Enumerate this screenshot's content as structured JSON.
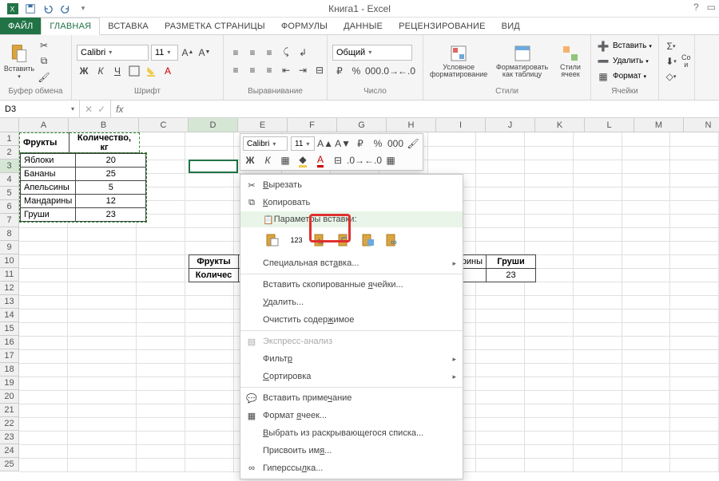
{
  "title": "Книга1 - Excel",
  "tabs": {
    "file": "ФАЙЛ",
    "home": "ГЛАВНАЯ",
    "insert": "ВСТАВКА",
    "layout": "РАЗМЕТКА СТРАНИЦЫ",
    "formulas": "ФОРМУЛЫ",
    "data": "ДАННЫЕ",
    "review": "РЕЦЕНЗИРОВАНИЕ",
    "view": "ВИД"
  },
  "ribbon": {
    "paste": "Вставить",
    "clipboard": "Буфер обмена",
    "font_name": "Calibri",
    "font_size": "11",
    "font_group": "Шрифт",
    "align_group": "Выравнивание",
    "number_format": "Общий",
    "number_group": "Число",
    "cond_fmt": "Условное форматирование",
    "fmt_table": "Форматировать как таблицу",
    "cell_styles": "Стили ячеек",
    "styles_group": "Стили",
    "insert_cells": "Вставить",
    "delete_cells": "Удалить",
    "format_cells": "Формат",
    "cells_group": "Ячейки",
    "bold": "Ж",
    "italic": "К",
    "underline": "Ч",
    "sort_label": "Со и"
  },
  "namebox": "D3",
  "columns": [
    "A",
    "B",
    "C",
    "D",
    "E",
    "F",
    "G",
    "H",
    "I",
    "J",
    "K",
    "L",
    "M",
    "N"
  ],
  "table1": {
    "headers": [
      "Фрукты",
      "Количество, кг"
    ],
    "rows": [
      [
        "Яблоки",
        "20"
      ],
      [
        "Бананы",
        "25"
      ],
      [
        "Апельсины",
        "5"
      ],
      [
        "Мандарины",
        "12"
      ],
      [
        "Груши",
        "23"
      ]
    ]
  },
  "table2": {
    "row1": [
      "Фрукты",
      "",
      "",
      "",
      "",
      "рины",
      "Груши"
    ],
    "row2": [
      "Количес",
      "",
      "",
      "",
      "",
      "2",
      "23"
    ]
  },
  "mini": {
    "font": "Calibri",
    "size": "11"
  },
  "menu": {
    "cut": "Вырезать",
    "copy": "Копировать",
    "paste_hdr": "Параметры вставки:",
    "paste_123": "123",
    "paste_special": "Специальная вставка...",
    "insert_copied": "Вставить скопированные ячейки...",
    "delete": "Удалить...",
    "clear": "Очистить содержимое",
    "quick": "Экспресс-анализ",
    "filter": "Фильтр",
    "sort": "Сортировка",
    "comment": "Вставить примечание",
    "format": "Формат ячеек...",
    "dropdown": "Выбрать из раскрывающегося списка...",
    "name": "Присвоить имя...",
    "hyperlink": "Гиперссылка..."
  }
}
